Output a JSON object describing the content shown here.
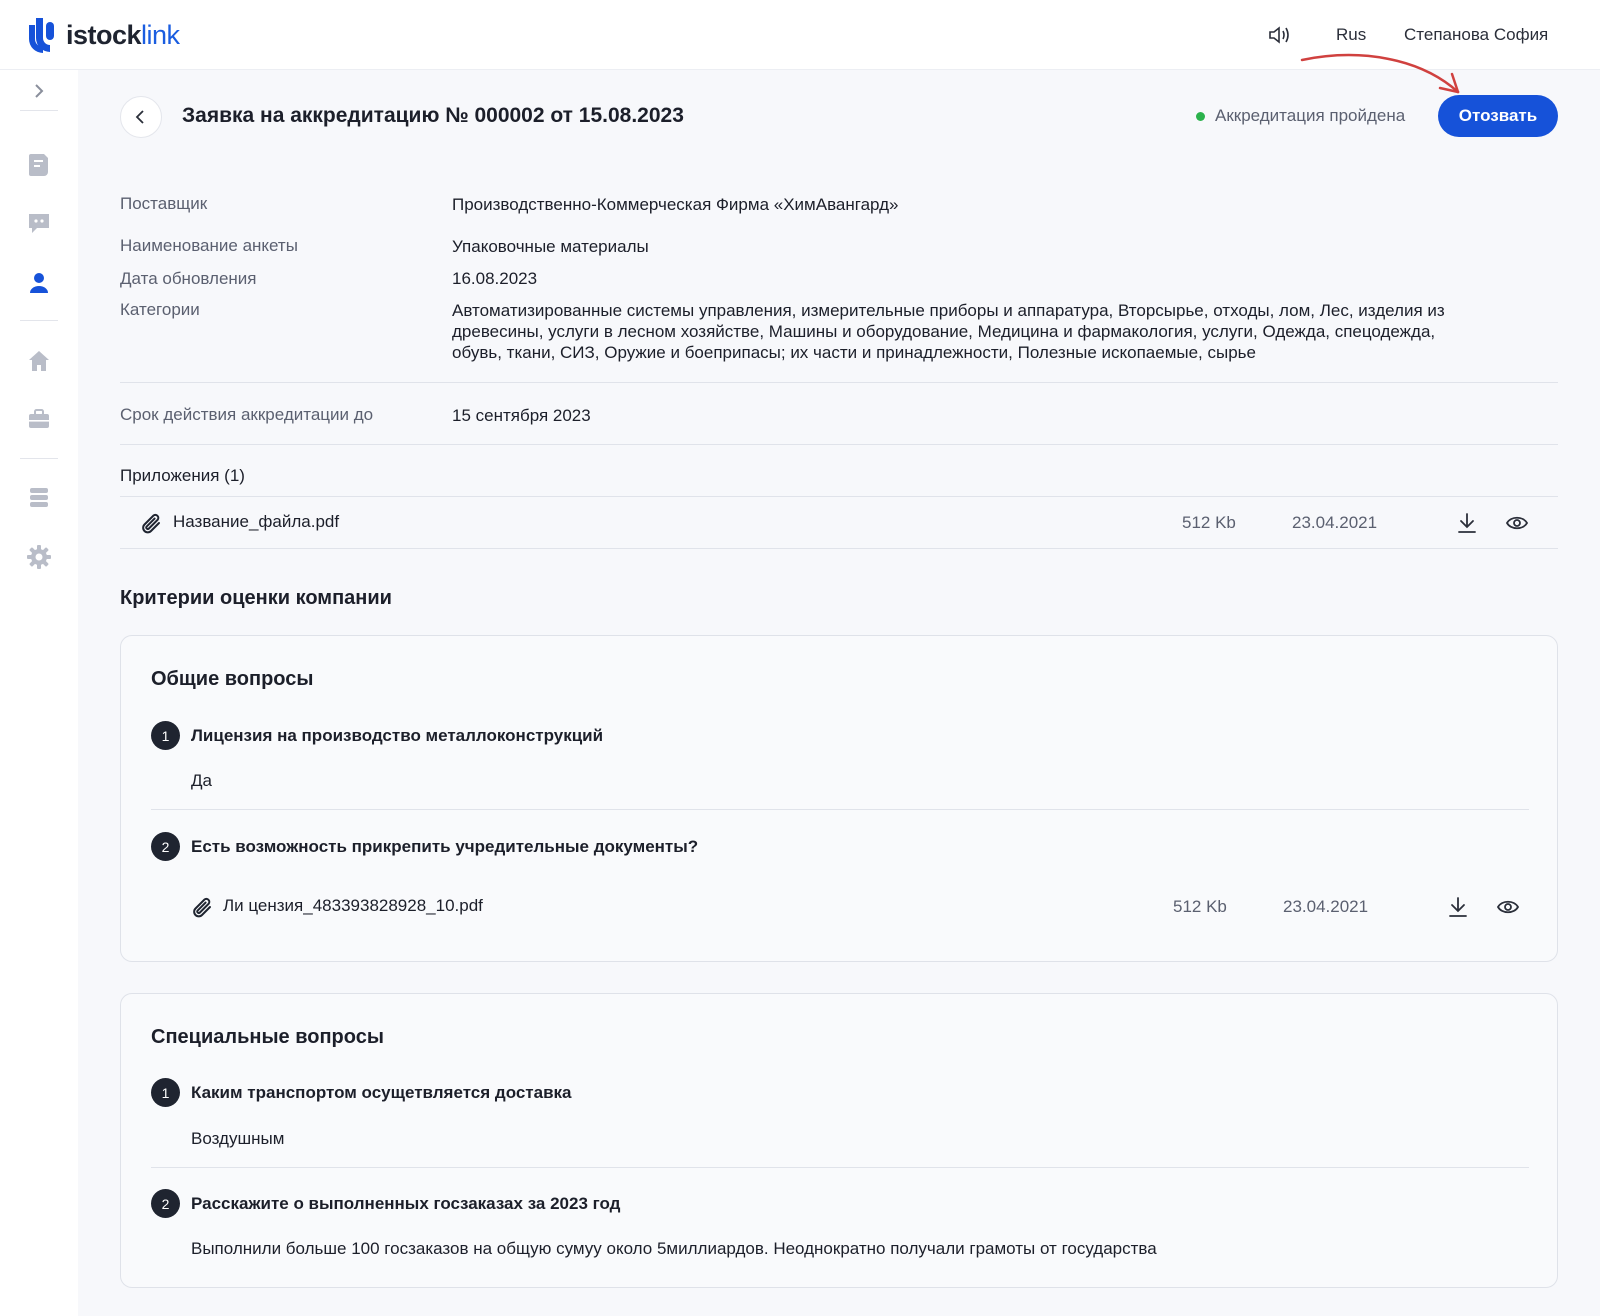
{
  "header": {
    "logo_main": "istock",
    "logo_accent": "link",
    "language": "Rus",
    "user_name": "Степанова София"
  },
  "page": {
    "title": "Заявка на аккредитацию № 000002 от 15.08.2023",
    "status": "Аккредитация пройдена",
    "revoke_label": "Отозвать"
  },
  "details": {
    "supplier_label": "Поставщик",
    "supplier_value": "Производственно-Коммерческая Фирма «ХимАвангард»",
    "form_label": "Наименование анкеты",
    "form_value": "Упаковочные материалы",
    "updated_label": "Дата обновления",
    "updated_value": "16.08.2023",
    "categories_label": "Категории",
    "categories_line1": "Автоматизированные системы управления, измерительные приборы и аппаратура, Вторсырье, отходы, лом, Лес, изделия из",
    "categories_line2": "древесины, услуги в лесном хозяйстве, Машины и оборудование, Медицина и фармакология, услуги, Одежда, спецодежда,",
    "categories_line3": "обувь, ткани, СИЗ, Оружие и боеприпасы; их части и принадлежности, Полезные ископаемые, сырье",
    "validity_label": "Срок действия аккредитации до",
    "validity_value": "15 сентября 2023"
  },
  "attachments": {
    "title": "Приложения (1)",
    "file_name": "Название_файла.pdf",
    "file_size": "512 Kb",
    "file_date": "23.04.2021"
  },
  "criteria": {
    "title": "Критерии оценки компании",
    "general": {
      "title": "Общие вопросы",
      "q1_num": "1",
      "q1_text": "Лицензия на производство металлоконструкций",
      "q1_answer": "Да",
      "q2_num": "2",
      "q2_text": "Есть возможность прикрепить учредительные документы?",
      "q2_file": "Ли цензия_483393828928_10.pdf",
      "q2_size": "512 Kb",
      "q2_date": "23.04.2021"
    },
    "special": {
      "title": "Специальные вопросы",
      "q1_num": "1",
      "q1_text": "Каким транспортом осущетвляется доставка",
      "q1_answer": "Воздушным",
      "q2_num": "2",
      "q2_text": "Расскажите о выполненных госзаказах за 2023 год",
      "q2_answer": "Выполнили больше 100 госзаказов на общую сумуу около 5миллиардов. Неоднократно получали грамоты от государства"
    }
  },
  "colors": {
    "accent": "#1652d9",
    "status_ok": "#2bb24c",
    "annotation": "#d0413f"
  }
}
